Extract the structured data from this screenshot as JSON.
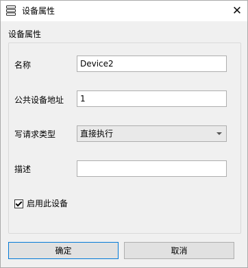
{
  "window": {
    "title": "设备属性",
    "close_glyph": "✕"
  },
  "group": {
    "title": "设备属性"
  },
  "fields": {
    "name_label": "名称",
    "name_value": "Device2",
    "address_label": "公共设备地址",
    "address_value": "1",
    "write_type_label": "写请求类型",
    "write_type_value": "直接执行",
    "description_label": "描述",
    "description_value": ""
  },
  "enable": {
    "label": "启用此设备",
    "checked": true
  },
  "buttons": {
    "ok": "确定",
    "cancel": "取消"
  },
  "icons": {
    "title": "stacked-list-icon",
    "close": "close-icon",
    "dropdown": "chevron-down-icon",
    "check": "checkmark-icon"
  },
  "colors": {
    "window_bg": "#f0f0f0",
    "titlebar_bg": "#ffffff",
    "focus_border": "#0078d7"
  }
}
